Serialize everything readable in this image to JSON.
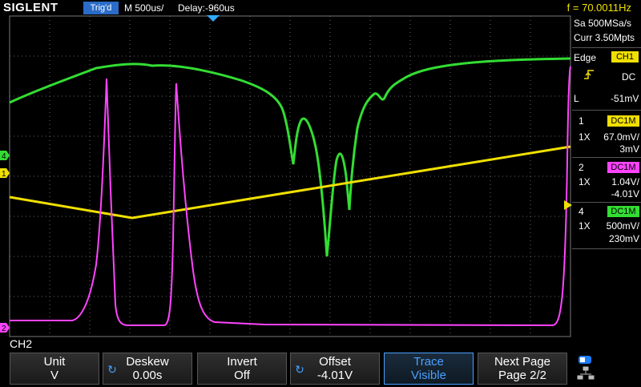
{
  "header": {
    "brand": "SIGLENT",
    "trig_status": "Trig'd",
    "timebase": "M 500us/",
    "delay": "Delay:-960us",
    "frequency": "f = 70.0011Hz"
  },
  "acquisition": {
    "sample_rate": "Sa 500MSa/s",
    "memory": "Curr 3.50Mpts"
  },
  "trigger": {
    "type_label": "Edge",
    "source": "CH1",
    "coupling": "DC",
    "level_prefix": "L",
    "level": "-51mV",
    "slope_icon": "rising-edge-icon"
  },
  "channels": [
    {
      "num": "1",
      "coupling": "DC1M",
      "probe": "1X",
      "scale": "67.0mV/",
      "offset": "3mV",
      "color": "#f0e000"
    },
    {
      "num": "2",
      "coupling": "DC1M",
      "probe": "1X",
      "scale": "1.04V/",
      "offset": "-4.01V",
      "color": "#ff44ff"
    },
    {
      "num": "4",
      "coupling": "DC1M",
      "probe": "1X",
      "scale": "500mV/",
      "offset": "230mV",
      "color": "#33dd33"
    }
  ],
  "markers": {
    "ch4": "4",
    "ch1": "1",
    "ch2": "2"
  },
  "menu": {
    "title": "CH2",
    "keys": [
      {
        "l1": "Unit",
        "l2": "V"
      },
      {
        "l1": "Deskew",
        "l2": "0.00s"
      },
      {
        "l1": "Invert",
        "l2": "Off"
      },
      {
        "l1": "Offset",
        "l2": "-4.01V"
      },
      {
        "l1": "Trace",
        "l2": "Visible"
      },
      {
        "l1": "Next Page",
        "l2": "Page 2/2"
      }
    ]
  },
  "colors": {
    "ch1": "#f0e000",
    "ch2": "#ff44ff",
    "ch4": "#33dd33",
    "accent": "#2a6cc8",
    "grid": "#555555"
  }
}
